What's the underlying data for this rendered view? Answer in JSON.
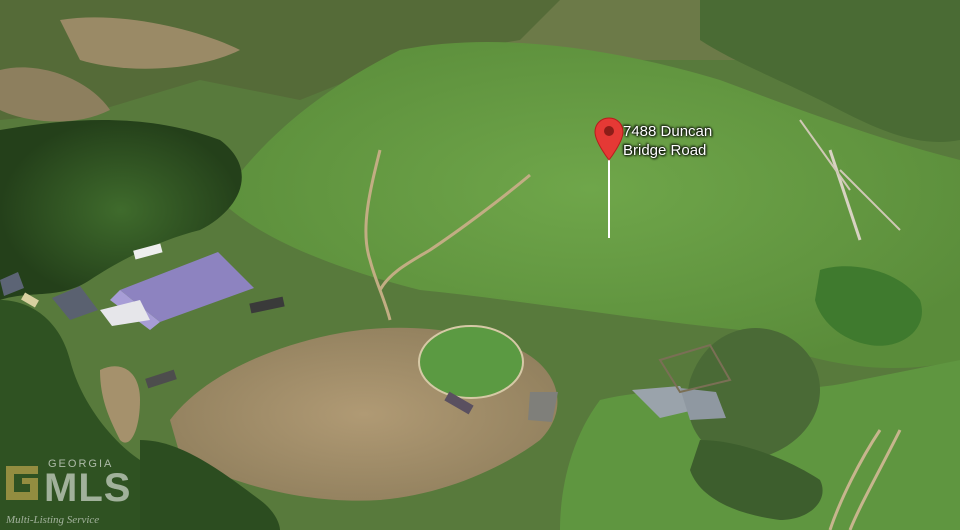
{
  "map": {
    "marker": {
      "label": "7488 Duncan\nBridge Road",
      "color": "#e53935",
      "icon": "map-pin-icon"
    },
    "watermark": {
      "brand_top": "GEORGIA",
      "brand_main": "MLS",
      "brand_sub": "Multi-Listing Service",
      "logo_icon": "georgia-mls-logo-icon"
    }
  }
}
